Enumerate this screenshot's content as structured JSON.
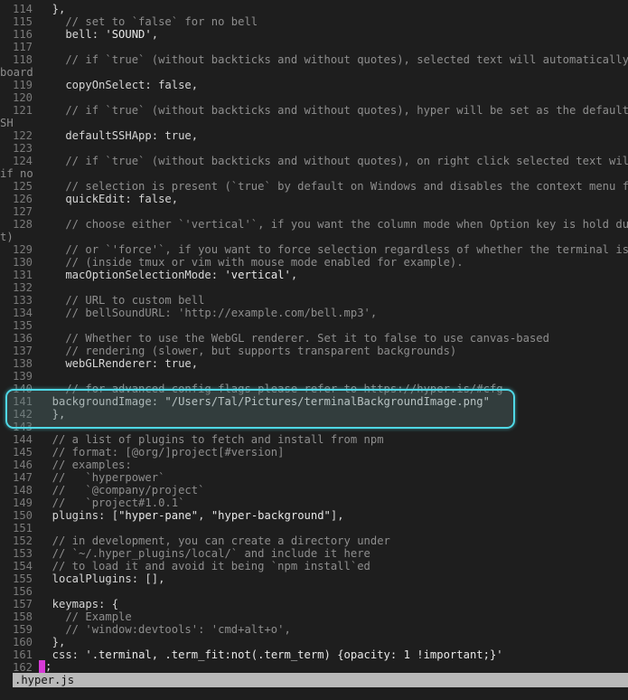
{
  "lines": [
    {
      "n": "114",
      "parts": [
        {
          "t": "  },",
          "c": "t-plain"
        }
      ]
    },
    {
      "n": "115",
      "parts": [
        {
          "t": "    // set to `false` for no bell",
          "c": "t-com"
        }
      ]
    },
    {
      "n": "116",
      "parts": [
        {
          "t": "    bell: ",
          "c": "t-plain"
        },
        {
          "t": "'SOUND'",
          "c": "t-str"
        },
        {
          "t": ",",
          "c": "t-plain"
        }
      ]
    },
    {
      "n": "117",
      "parts": []
    },
    {
      "n": "118",
      "parts": [
        {
          "t": "    // if `true` (without backticks and without quotes), selected text will automatically be c",
          "c": "t-com"
        }
      ]
    },
    {
      "wrap": "board"
    },
    {
      "n": "119",
      "parts": [
        {
          "t": "    copyOnSelect: false,",
          "c": "t-plain"
        }
      ]
    },
    {
      "n": "120",
      "parts": []
    },
    {
      "n": "121",
      "parts": [
        {
          "t": "    // if `true` (without backticks and without quotes), hyper will be set as the default prot",
          "c": "t-com"
        }
      ]
    },
    {
      "wrap": "SH"
    },
    {
      "n": "122",
      "parts": [
        {
          "t": "    defaultSSHApp: true,",
          "c": "t-plain"
        }
      ]
    },
    {
      "n": "123",
      "parts": []
    },
    {
      "n": "124",
      "parts": [
        {
          "t": "    // if `true` (without backticks and without quotes), on right click selected text will be",
          "c": "t-com"
        }
      ]
    },
    {
      "wrap": "if no"
    },
    {
      "n": "125",
      "parts": [
        {
          "t": "    // selection is present (`true` by default on Windows and disables the context menu featu",
          "c": "t-com"
        }
      ]
    },
    {
      "n": "126",
      "parts": [
        {
          "t": "    quickEdit: false,",
          "c": "t-plain"
        }
      ]
    },
    {
      "n": "127",
      "parts": []
    },
    {
      "n": "128",
      "parts": [
        {
          "t": "    // choose either `'vertical'`, if you want the column mode when Option key is hold during",
          "c": "t-com"
        }
      ]
    },
    {
      "wrap": "t)"
    },
    {
      "n": "129",
      "parts": [
        {
          "t": "    // or `'force'`, if you want to force selection regardless of whether the terminal is in m",
          "c": "t-com"
        }
      ]
    },
    {
      "n": "130",
      "parts": [
        {
          "t": "    // (inside tmux or vim with mouse mode enabled for example).",
          "c": "t-com"
        }
      ]
    },
    {
      "n": "131",
      "parts": [
        {
          "t": "    macOptionSelectionMode: ",
          "c": "t-plain"
        },
        {
          "t": "'vertical'",
          "c": "t-str"
        },
        {
          "t": ",",
          "c": "t-plain"
        }
      ]
    },
    {
      "n": "132",
      "parts": []
    },
    {
      "n": "133",
      "parts": [
        {
          "t": "    // URL to custom bell",
          "c": "t-com"
        }
      ]
    },
    {
      "n": "134",
      "parts": [
        {
          "t": "    // bellSoundURL: 'http://example.com/bell.mp3',",
          "c": "t-com"
        }
      ]
    },
    {
      "n": "135",
      "parts": []
    },
    {
      "n": "136",
      "parts": [
        {
          "t": "    // Whether to use the WebGL renderer. Set it to false to use canvas-based",
          "c": "t-com"
        }
      ]
    },
    {
      "n": "137",
      "parts": [
        {
          "t": "    // rendering (slower, but supports transparent backgrounds)",
          "c": "t-com"
        }
      ]
    },
    {
      "n": "138",
      "parts": [
        {
          "t": "    webGLRenderer: true,",
          "c": "t-plain"
        }
      ]
    },
    {
      "n": "139",
      "parts": []
    },
    {
      "n": "140",
      "parts": [
        {
          "t": "    // for advanced config flags please refer to https://hyper.is/#cfg",
          "c": "t-com"
        }
      ]
    },
    {
      "n": "141",
      "parts": [
        {
          "t": "  backgroundImage: ",
          "c": "t-plain"
        },
        {
          "t": "\"/Users/Tal/Pictures/terminalBackgroundImage.png\"",
          "c": "t-str"
        }
      ]
    },
    {
      "n": "142",
      "parts": [
        {
          "t": "  },",
          "c": "t-plain"
        }
      ]
    },
    {
      "n": "143",
      "parts": []
    },
    {
      "n": "144",
      "parts": [
        {
          "t": "  // a list of plugins to fetch and install from npm",
          "c": "t-com"
        }
      ]
    },
    {
      "n": "145",
      "parts": [
        {
          "t": "  // format: [@org/]project[#version]",
          "c": "t-com"
        }
      ]
    },
    {
      "n": "146",
      "parts": [
        {
          "t": "  // examples:",
          "c": "t-com"
        }
      ]
    },
    {
      "n": "147",
      "parts": [
        {
          "t": "  //   `hyperpower`",
          "c": "t-com"
        }
      ]
    },
    {
      "n": "148",
      "parts": [
        {
          "t": "  //   `@company/project`",
          "c": "t-com"
        }
      ]
    },
    {
      "n": "149",
      "parts": [
        {
          "t": "  //   `project#1.0.1`",
          "c": "t-com"
        }
      ]
    },
    {
      "n": "150",
      "parts": [
        {
          "t": "  plugins: [",
          "c": "t-plain"
        },
        {
          "t": "\"hyper-pane\"",
          "c": "t-str"
        },
        {
          "t": ", ",
          "c": "t-plain"
        },
        {
          "t": "\"hyper-background\"",
          "c": "t-str"
        },
        {
          "t": "],",
          "c": "t-plain"
        }
      ]
    },
    {
      "n": "151",
      "parts": []
    },
    {
      "n": "152",
      "parts": [
        {
          "t": "  // in development, you can create a directory under",
          "c": "t-com"
        }
      ]
    },
    {
      "n": "153",
      "parts": [
        {
          "t": "  // `~/.hyper_plugins/local/` and include it here",
          "c": "t-com"
        }
      ]
    },
    {
      "n": "154",
      "parts": [
        {
          "t": "  // to load it and avoid it being `npm install`ed",
          "c": "t-com"
        }
      ]
    },
    {
      "n": "155",
      "parts": [
        {
          "t": "  localPlugins: [],",
          "c": "t-plain"
        }
      ]
    },
    {
      "n": "156",
      "parts": []
    },
    {
      "n": "157",
      "parts": [
        {
          "t": "  keymaps: {",
          "c": "t-plain"
        }
      ]
    },
    {
      "n": "158",
      "parts": [
        {
          "t": "    // Example",
          "c": "t-com"
        }
      ]
    },
    {
      "n": "159",
      "parts": [
        {
          "t": "    // 'window:devtools': 'cmd+alt+o',",
          "c": "t-com"
        }
      ]
    },
    {
      "n": "160",
      "parts": [
        {
          "t": "  },",
          "c": "t-plain"
        }
      ]
    },
    {
      "n": "161",
      "parts": [
        {
          "t": "  css: ",
          "c": "t-plain"
        },
        {
          "t": "'.terminal, .term_fit:not(.term_term) {opacity: 1 !important;}'",
          "c": "t-str"
        }
      ]
    },
    {
      "n": "162",
      "parts": [
        {
          "t": " ",
          "c": "t-plain"
        }
      ]
    }
  ],
  "cursor_line_text": ";",
  "status": {
    "filename": ".hyper.js"
  },
  "colors": {
    "background": "#1e1e1e",
    "highlight_border": "#4fd8e6",
    "cursor": "#d63ad6",
    "status_bar": "#b9b9b9"
  }
}
